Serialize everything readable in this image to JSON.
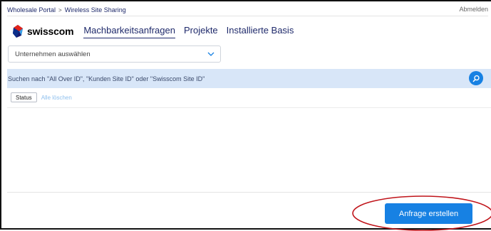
{
  "breadcrumb": {
    "items": [
      "Wholesale Portal",
      "Wireless Site Sharing"
    ],
    "separator": ">"
  },
  "topbar": {
    "logout_label": "Abmelden"
  },
  "brand": {
    "name": "swisscom"
  },
  "nav": {
    "items": [
      {
        "label": "Machbarkeitsanfragen",
        "active": true
      },
      {
        "label": "Projekte",
        "active": false
      },
      {
        "label": "Installierte Basis",
        "active": false
      }
    ]
  },
  "company_select": {
    "placeholder": "Unternehmen auswählen"
  },
  "search": {
    "placeholder": "Suchen nach \"All Over ID\", \"Kunden Site ID\" oder \"Swisscom Site ID\""
  },
  "filters": {
    "chip_label": "Status",
    "clear_all_label": "Alle löschen"
  },
  "actions": {
    "create_request_label": "Anfrage erstellen"
  },
  "colors": {
    "accent": "#1781e3",
    "nav_text": "#1f2a6b",
    "search_bg": "#d8e6f8",
    "annotation": "#c0141a"
  }
}
